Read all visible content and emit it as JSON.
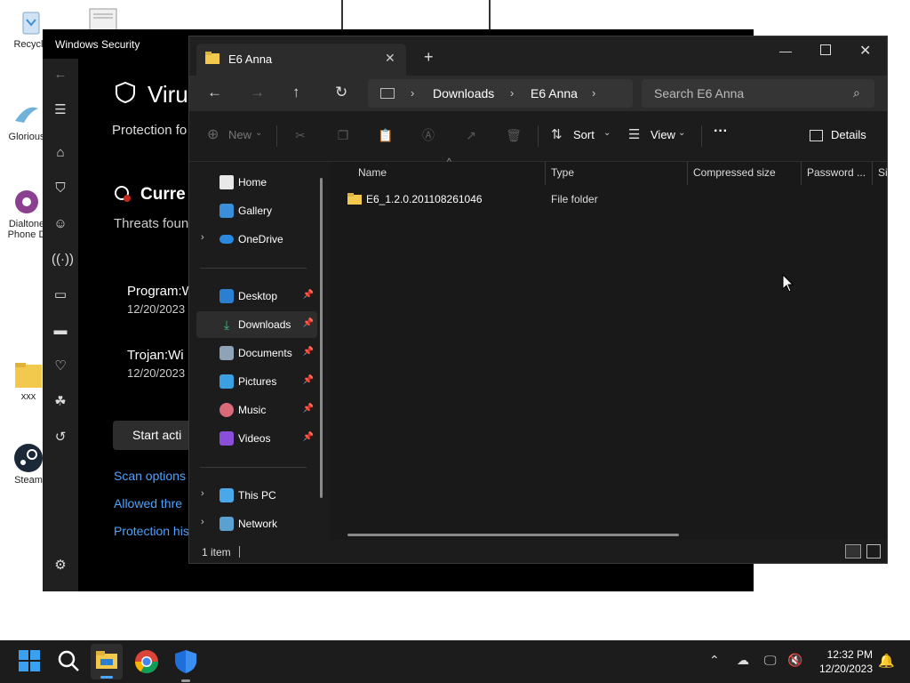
{
  "desktop": {
    "icons": [
      {
        "label": "Recycle"
      },
      {
        "label": "Glorious"
      },
      {
        "label": "Dialtone Phone D"
      },
      {
        "label": "xxx"
      },
      {
        "label": "Steam"
      }
    ]
  },
  "security": {
    "title": "Windows Security",
    "heading": "Viru",
    "subheading": "Protection fo",
    "current": "Curre",
    "threats": "Threats foun",
    "items": [
      {
        "name": "Program:W",
        "date": "12/20/2023"
      },
      {
        "name": "Trojan:Wi",
        "date": "12/20/2023"
      }
    ],
    "start_button": "Start acti",
    "links": [
      "Scan options",
      "Allowed thre",
      "Protection his"
    ]
  },
  "explorer": {
    "tab_title": "E6 Anna",
    "breadcrumb": [
      "Downloads",
      "E6 Anna"
    ],
    "search_placeholder": "Search E6 Anna",
    "toolbar": {
      "new_label": "New",
      "sort_label": "Sort",
      "view_label": "View",
      "more_label": "···",
      "details_label": "Details"
    },
    "columns": [
      "Name",
      "Type",
      "Compressed size",
      "Password ...",
      "Si"
    ],
    "rows": [
      {
        "name": "E6_1.2.0.201108261046",
        "type": "File folder"
      }
    ],
    "nav": {
      "home": "Home",
      "gallery": "Gallery",
      "onedrive": "OneDrive",
      "desktop": "Desktop",
      "downloads": "Downloads",
      "documents": "Documents",
      "pictures": "Pictures",
      "music": "Music",
      "videos": "Videos",
      "thispc": "This PC",
      "network": "Network"
    },
    "status": "1 item"
  },
  "taskbar": {
    "time": "12:32 PM",
    "date": "12/20/2023"
  }
}
